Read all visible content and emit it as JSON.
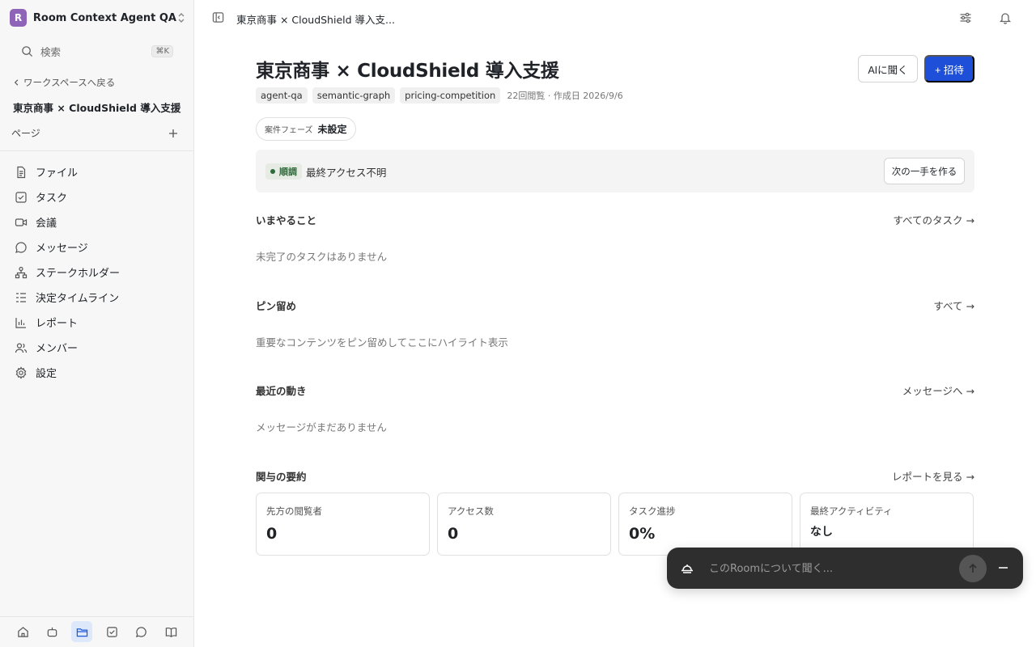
{
  "workspace": {
    "initial": "R",
    "name": "Room Context Agent QA"
  },
  "search": {
    "placeholder": "検索",
    "shortcut": "⌘K"
  },
  "sidebar": {
    "back_label": "ワークスペースへ戻る",
    "room_title": "東京商事 × CloudShield 導入支援",
    "pages_label": "ページ",
    "items": [
      {
        "label": "ファイル",
        "icon": "file-icon"
      },
      {
        "label": "タスク",
        "icon": "task-check-icon"
      },
      {
        "label": "会議",
        "icon": "video-icon"
      },
      {
        "label": "メッセージ",
        "icon": "message-icon"
      },
      {
        "label": "ステークホルダー",
        "icon": "org-chart-icon"
      },
      {
        "label": "決定タイムライン",
        "icon": "timeline-icon"
      },
      {
        "label": "レポート",
        "icon": "bar-chart-icon"
      },
      {
        "label": "メンバー",
        "icon": "members-icon"
      },
      {
        "label": "設定",
        "icon": "gear-icon"
      }
    ]
  },
  "topbar": {
    "title": "東京商事 × CloudShield 導入支..."
  },
  "page": {
    "title": "東京商事 × CloudShield 導入支援",
    "ask_ai_label": "AIに聞く",
    "invite_label": "+ 招待",
    "tags": [
      "agent-qa",
      "semantic-graph",
      "pricing-competition"
    ],
    "meta": "22回閲覧 · 作成日 2026/9/6",
    "phase_label": "案件フェーズ",
    "phase_value": "未設定"
  },
  "status": {
    "badge": "順調",
    "text": "最終アクセス不明",
    "next_action_label": "次の一手を作る",
    "color": "#2f6b3a"
  },
  "sections": {
    "todo": {
      "title": "いまやること",
      "link": "すべてのタスク →",
      "empty": "未完了のタスクはありません"
    },
    "pinned": {
      "title": "ピン留め",
      "link": "すべて →",
      "empty": "重要なコンテンツをピン留めしてここにハイライト表示"
    },
    "recent": {
      "title": "最近の動き",
      "link": "メッセージへ →",
      "empty": "メッセージがまだありません"
    },
    "engagement": {
      "title": "関与の要約",
      "link": "レポートを見る →"
    }
  },
  "stats": [
    {
      "label": "先方の閲覧者",
      "value": "0"
    },
    {
      "label": "アクセス数",
      "value": "0"
    },
    {
      "label": "タスク進捗",
      "value": "0%"
    },
    {
      "label": "最終アクティビティ",
      "value": "なし"
    }
  ],
  "chat": {
    "placeholder": "このRoomについて聞く..."
  },
  "colors": {
    "accent": "#1d4fd8",
    "avatar": "#8e63b8"
  }
}
